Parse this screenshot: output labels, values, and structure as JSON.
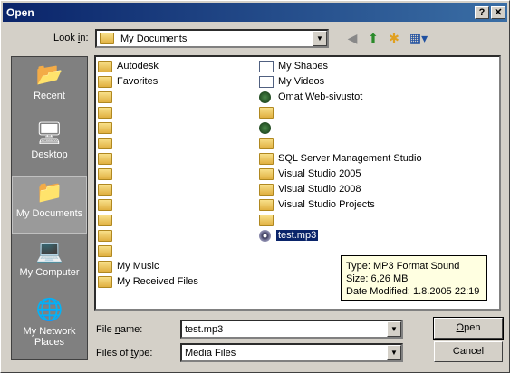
{
  "window": {
    "title": "Open",
    "help_btn": "?",
    "close_btn": "✕"
  },
  "lookin": {
    "label": "Look in:",
    "value": "My Documents",
    "dropdown": "▼"
  },
  "toolbar": {
    "back_icon": "back-icon",
    "up_icon": "up-folder-icon",
    "new_folder_icon": "new-folder-icon",
    "views_icon": "views-menu-icon"
  },
  "places": [
    {
      "label": "Recent",
      "icon": "recent-icon"
    },
    {
      "label": "Desktop",
      "icon": "desktop-icon"
    },
    {
      "label": "My Documents",
      "icon": "my-documents-icon"
    },
    {
      "label": "My Computer",
      "icon": "my-computer-icon"
    },
    {
      "label": "My Network Places",
      "icon": "network-places-icon"
    }
  ],
  "files_left": [
    {
      "name": "Autodesk",
      "type": "folder"
    },
    {
      "name": "Favorites",
      "type": "folder"
    },
    {
      "name": "",
      "type": "folder"
    },
    {
      "name": "",
      "type": "folder"
    },
    {
      "name": "",
      "type": "folder"
    },
    {
      "name": "",
      "type": "folder"
    },
    {
      "name": "",
      "type": "folder"
    },
    {
      "name": "",
      "type": "folder"
    },
    {
      "name": "",
      "type": "folder"
    },
    {
      "name": "",
      "type": "folder"
    },
    {
      "name": "",
      "type": "folder"
    },
    {
      "name": "",
      "type": "folder"
    },
    {
      "name": "",
      "type": "folder"
    },
    {
      "name": "My Music",
      "type": "folder"
    },
    {
      "name": "My Received Files",
      "type": "folder"
    }
  ],
  "files_right": [
    {
      "name": "My Shapes",
      "type": "doc"
    },
    {
      "name": "My Videos",
      "type": "doc"
    },
    {
      "name": "Omat Web-sivustot",
      "type": "web"
    },
    {
      "name": "",
      "type": "folder"
    },
    {
      "name": "",
      "type": "web"
    },
    {
      "name": "",
      "type": "folder"
    },
    {
      "name": "SQL Server Management Studio",
      "type": "folder"
    },
    {
      "name": "Visual Studio 2005",
      "type": "folder"
    },
    {
      "name": "Visual Studio 2008",
      "type": "folder"
    },
    {
      "name": "Visual Studio Projects",
      "type": "folder"
    },
    {
      "name": "",
      "type": "folder"
    },
    {
      "name": "test.mp3",
      "type": "mp3",
      "selected": true
    }
  ],
  "tooltip": {
    "line1": "Type: MP3 Format Sound",
    "line2": "Size: 6,26 MB",
    "line3": "Date Modified: 1.8.2005 22:19"
  },
  "filename": {
    "label_pre": "File ",
    "label_u": "n",
    "label_post": "ame:",
    "value": "test.mp3"
  },
  "filetype": {
    "label_pre": "Files of ",
    "label_u": "t",
    "label_post": "ype:",
    "value": "Media Files"
  },
  "buttons": {
    "open_u": "O",
    "open_rest": "pen",
    "cancel": "Cancel"
  }
}
